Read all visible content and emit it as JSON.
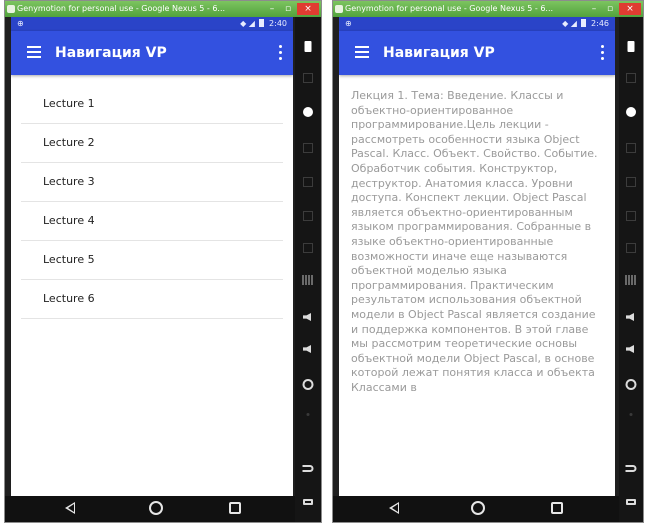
{
  "windows": {
    "left": {
      "title": "Genymotion for personal use - Google Nexus 5 - 6...",
      "status_left": "⊕",
      "status_right": "2:40",
      "app_title": "Навигация VP",
      "lectures": [
        "Lecture 1",
        "Lecture 2",
        "Lecture 3",
        "Lecture 4",
        "Lecture 5",
        "Lecture 6"
      ]
    },
    "right": {
      "title": "Genymotion for personal use - Google Nexus 5 - 6...",
      "status_left": "⊕",
      "status_right": "2:46",
      "app_title": "Навигация VP",
      "lecture_text": "Лекция 1. Тема: Введение. Классы и объектно-ориентированное программирование.Цель лекции - рассмотреть особенности языка Object Pascal. Класс. Объект. Свойство. Событие. Обработчик события. Конструктор, деструктор. Анатомия класса. Уровни доступа. Конспект лекции. Object Pascal является объектно-ориентированным языком программирования. Собранные в языке объектно-ориентированные возможности иначе еще называются объектной моделью языка программирования. Практическим результатом использования объектной модели в Object Pascal является создание и поддержка компонентов. В этой главе мы рассмотрим теоретические основы объектной модели Object Pascal, в основе которой лежат понятия класса и объекта Классами в"
    }
  },
  "window_buttons": {
    "minimize": "–",
    "maximize": "▫",
    "close": "×"
  },
  "colors": {
    "titlebar": "#5fb043",
    "statusbar": "#2a44c8",
    "appbar": "#3351e0",
    "close": "#e03c31"
  }
}
